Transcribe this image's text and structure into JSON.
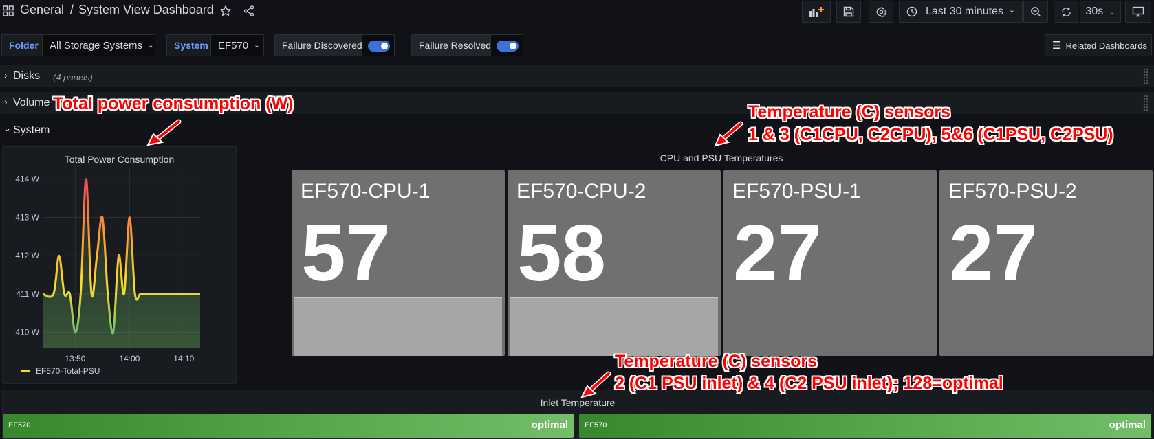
{
  "header": {
    "breadcrumb_folder": "General",
    "breadcrumb_separator": "/",
    "dashboard_title": "System View Dashboard",
    "time_range": "Last 30 minutes",
    "refresh_interval": "30s"
  },
  "variables": {
    "folder_label": "Folder",
    "folder_value": "All Storage Systems",
    "system_label": "System",
    "system_value": "EF570",
    "failure_discovered_label": "Failure Discovered",
    "failure_resolved_label": "Failure Resolved",
    "related_dashboards": "Related Dashboards"
  },
  "rows": {
    "disks_title": "Disks",
    "disks_panels": "(4 panels)",
    "volumes_title": "Volume",
    "system_title": "System"
  },
  "power_panel": {
    "title": "Total Power Consumption",
    "legend": "EF570-Total-PSU",
    "series_color": "#fade2a"
  },
  "chart_data": {
    "type": "line",
    "title": "Total Power Consumption",
    "ylim": [
      409.6,
      414.3
    ],
    "y_ticks": [
      "414 W",
      "413 W",
      "412 W",
      "411 W",
      "410 W"
    ],
    "x_ticks": [
      "13:50",
      "14:00",
      "14:10"
    ],
    "series": [
      {
        "name": "EF570-Total-PSU",
        "x": [
          "13:44",
          "13:46",
          "13:47",
          "13:48",
          "13:49",
          "13:50",
          "13:51",
          "13:52",
          "13:53",
          "13:54",
          "13:55",
          "13:56",
          "13:57",
          "13:58",
          "13:59",
          "14:00",
          "14:01",
          "14:02",
          "14:03",
          "14:04",
          "14:05",
          "14:06",
          "14:07",
          "14:08",
          "14:09",
          "14:10",
          "14:11",
          "14:12",
          "14:13"
        ],
        "values": [
          411,
          411,
          412,
          411,
          411,
          410,
          411,
          414,
          411,
          412,
          413,
          411,
          410,
          412,
          411,
          413,
          411,
          411,
          411,
          411,
          411,
          411,
          411,
          411,
          411,
          411,
          411,
          411,
          411
        ]
      }
    ]
  },
  "temps_panel": {
    "title": "CPU and PSU Temperatures",
    "stats": [
      {
        "name": "EF570-CPU-1",
        "value": "57"
      },
      {
        "name": "EF570-CPU-2",
        "value": "58"
      },
      {
        "name": "EF570-PSU-1",
        "value": "27"
      },
      {
        "name": "EF570-PSU-2",
        "value": "27"
      }
    ]
  },
  "inlet_panel": {
    "title": "Inlet Temperature",
    "gauges": [
      {
        "name": "EF570",
        "value": "optimal"
      },
      {
        "name": "EF570",
        "value": "optimal"
      }
    ]
  },
  "annotations": {
    "power": "Total power consumption (W)",
    "temps_line1": "Temperature (C) sensors",
    "temps_line2": "1 & 3 (C1CPU, C2CPU), 5&6 (C1PSU, C2PSU)",
    "inlet_line1": "Temperature (C) sensors",
    "inlet_line2": "2 (C1 PSU inlet) & 4 (C2 PSU inlet); 128=optimal",
    "color": "#ff0000"
  }
}
